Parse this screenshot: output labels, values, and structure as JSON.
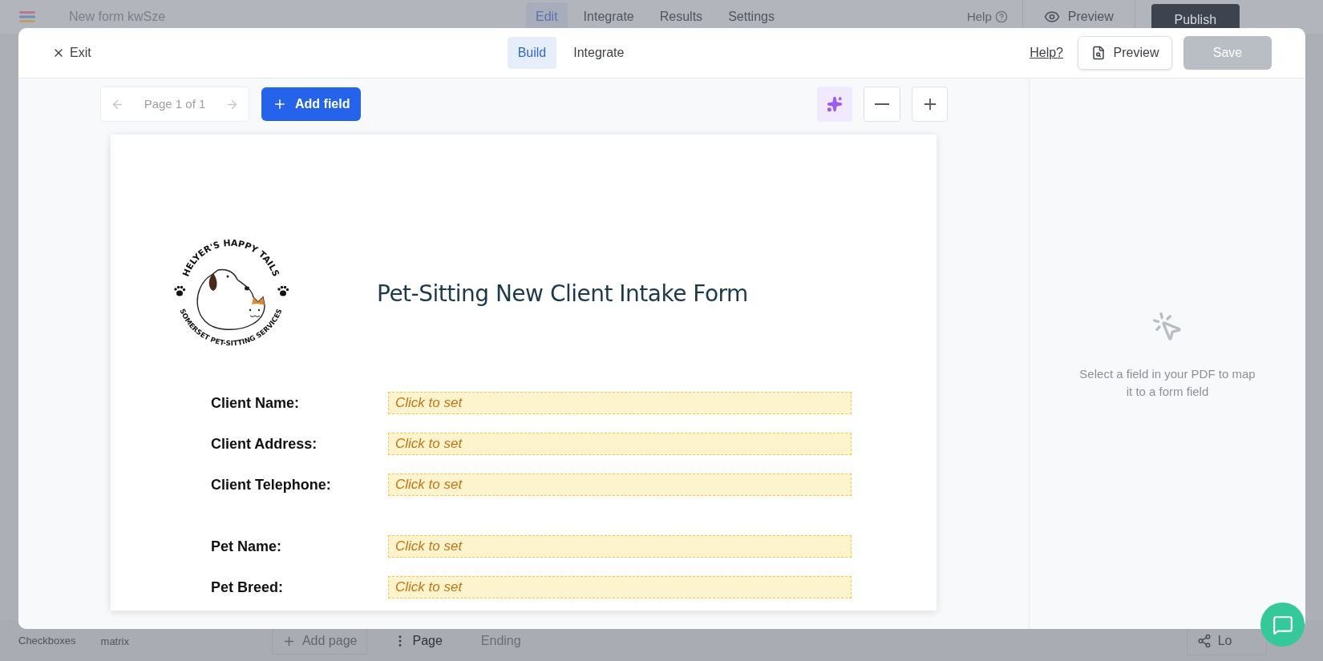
{
  "app_bar": {
    "title": "New form kwSze",
    "tabs": [
      {
        "label": "Edit",
        "selected": true
      },
      {
        "label": "Integrate",
        "selected": false
      },
      {
        "label": "Results",
        "selected": false
      },
      {
        "label": "Settings",
        "selected": false
      }
    ],
    "help": "Help",
    "preview": "Preview",
    "publish": "Publish"
  },
  "background_sidebar": {
    "items": [
      "Checkboxes",
      "matrix"
    ]
  },
  "bottom_bar": {
    "add_page": "Add page",
    "pages": [
      {
        "label": "Page",
        "selected": true
      },
      {
        "label": "Ending",
        "selected": false
      }
    ],
    "logic": "Lo"
  },
  "modal": {
    "exit": "Exit",
    "tabs": [
      {
        "label": "Build",
        "selected": true
      },
      {
        "label": "Integrate",
        "selected": false
      }
    ],
    "help_link": "Help?",
    "preview": "Preview",
    "save": {
      "label": "Save",
      "disabled": true
    },
    "pager": {
      "label": "Page 1 of 1"
    },
    "add_field": "Add field",
    "document": {
      "logo": {
        "top_text": "HELYER'S HAPPY TAILS",
        "bottom_text": "SOMERSET PET-SITTING SERVICES"
      },
      "title": "Pet-Sitting New Client Intake Form",
      "sections": [
        {
          "fields": [
            {
              "label": "Client Name:",
              "value": "Click to set"
            },
            {
              "label": "Client Address:",
              "value": "Click to set"
            },
            {
              "label": "Client Telephone:",
              "value": "Click to set"
            }
          ]
        },
        {
          "fields": [
            {
              "label": "Pet Name:",
              "value": "Click to set"
            },
            {
              "label": "Pet Breed:",
              "value": "Click to set"
            }
          ]
        }
      ]
    },
    "side_panel": {
      "hint": "Select a field in your PDF to map it to a form field"
    }
  }
}
